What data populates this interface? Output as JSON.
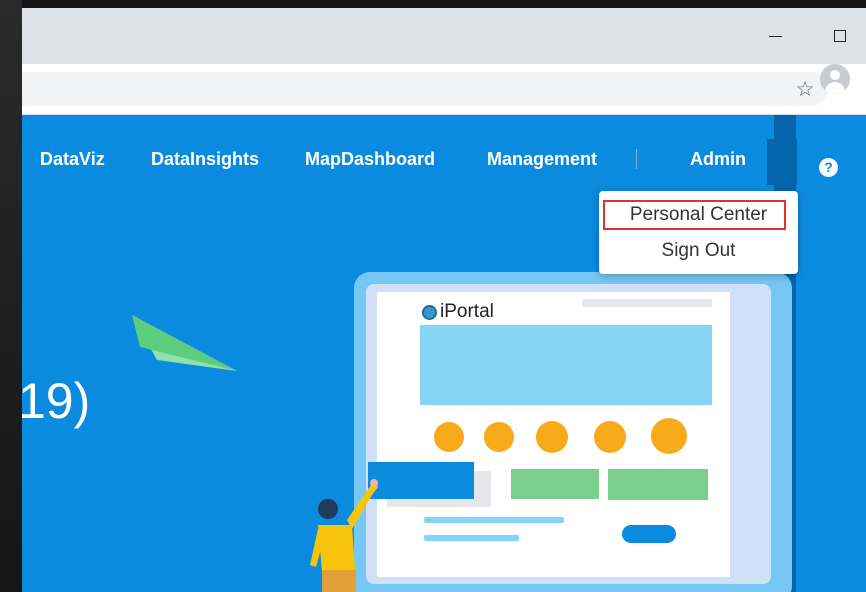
{
  "window": {
    "controls": {
      "minimize_icon": "minimize-icon",
      "maximize_icon": "maximize-icon"
    }
  },
  "toolbar": {
    "bookmark_icon": "star-icon",
    "profile_icon": "profile-avatar-icon"
  },
  "nav": {
    "items": [
      {
        "label": "DataViz"
      },
      {
        "label": "DataInsights"
      },
      {
        "label": "MapDashboard"
      },
      {
        "label": "Management"
      }
    ],
    "user": {
      "label": "Admin"
    },
    "help_icon": {
      "glyph": "?"
    }
  },
  "user_menu": {
    "items": [
      {
        "label": "Personal Center",
        "highlighted": true
      },
      {
        "label": "Sign Out"
      }
    ],
    "highlight_color": "#e5312e"
  },
  "hero": {
    "partial_title": "19)",
    "illustration": {
      "logo_text": "iPortal"
    }
  },
  "colors": {
    "page_bg": "#0a8be0",
    "nav_toggle_bg": "#0565ac",
    "card_bg": "#cfe0f7",
    "banner": "#86d4f5",
    "circles": "#f7ab1a",
    "green_blocks": "#7bcf8c",
    "blue_block": "#0a8be0"
  }
}
